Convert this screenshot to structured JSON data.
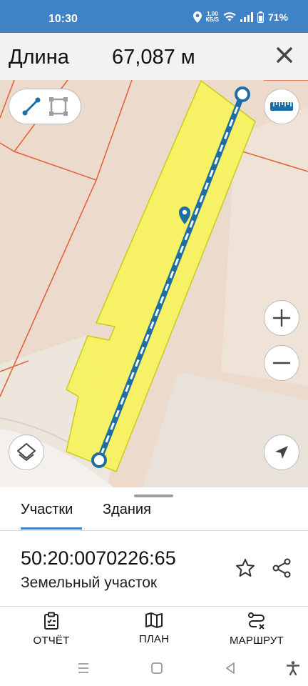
{
  "status_bar": {
    "time": "10:30",
    "speed_value": "1,00",
    "speed_unit": "КБ/S",
    "battery": "71%"
  },
  "measure": {
    "label": "Длина",
    "value": "67,087 м"
  },
  "map": {
    "parcel_fill": "#f6f35c",
    "parcel_stroke": "#c9cc1a",
    "line_color": "#1f6ea3",
    "boundary_color": "#e2653a"
  },
  "tabs": [
    {
      "label": "Участки",
      "active": true
    },
    {
      "label": "Здания",
      "active": false
    }
  ],
  "parcel": {
    "cadastral_number": "50:20:0070226:65",
    "type": "Земельный участок"
  },
  "bottom_nav": [
    {
      "label": "ОТЧЁТ",
      "icon": "report-icon"
    },
    {
      "label": "ПЛАН",
      "icon": "map-plan-icon"
    },
    {
      "label": "МАРШРУТ",
      "icon": "route-icon"
    }
  ],
  "colors": {
    "accent": "#3f82c6",
    "status_bar": "#3f82c6"
  }
}
